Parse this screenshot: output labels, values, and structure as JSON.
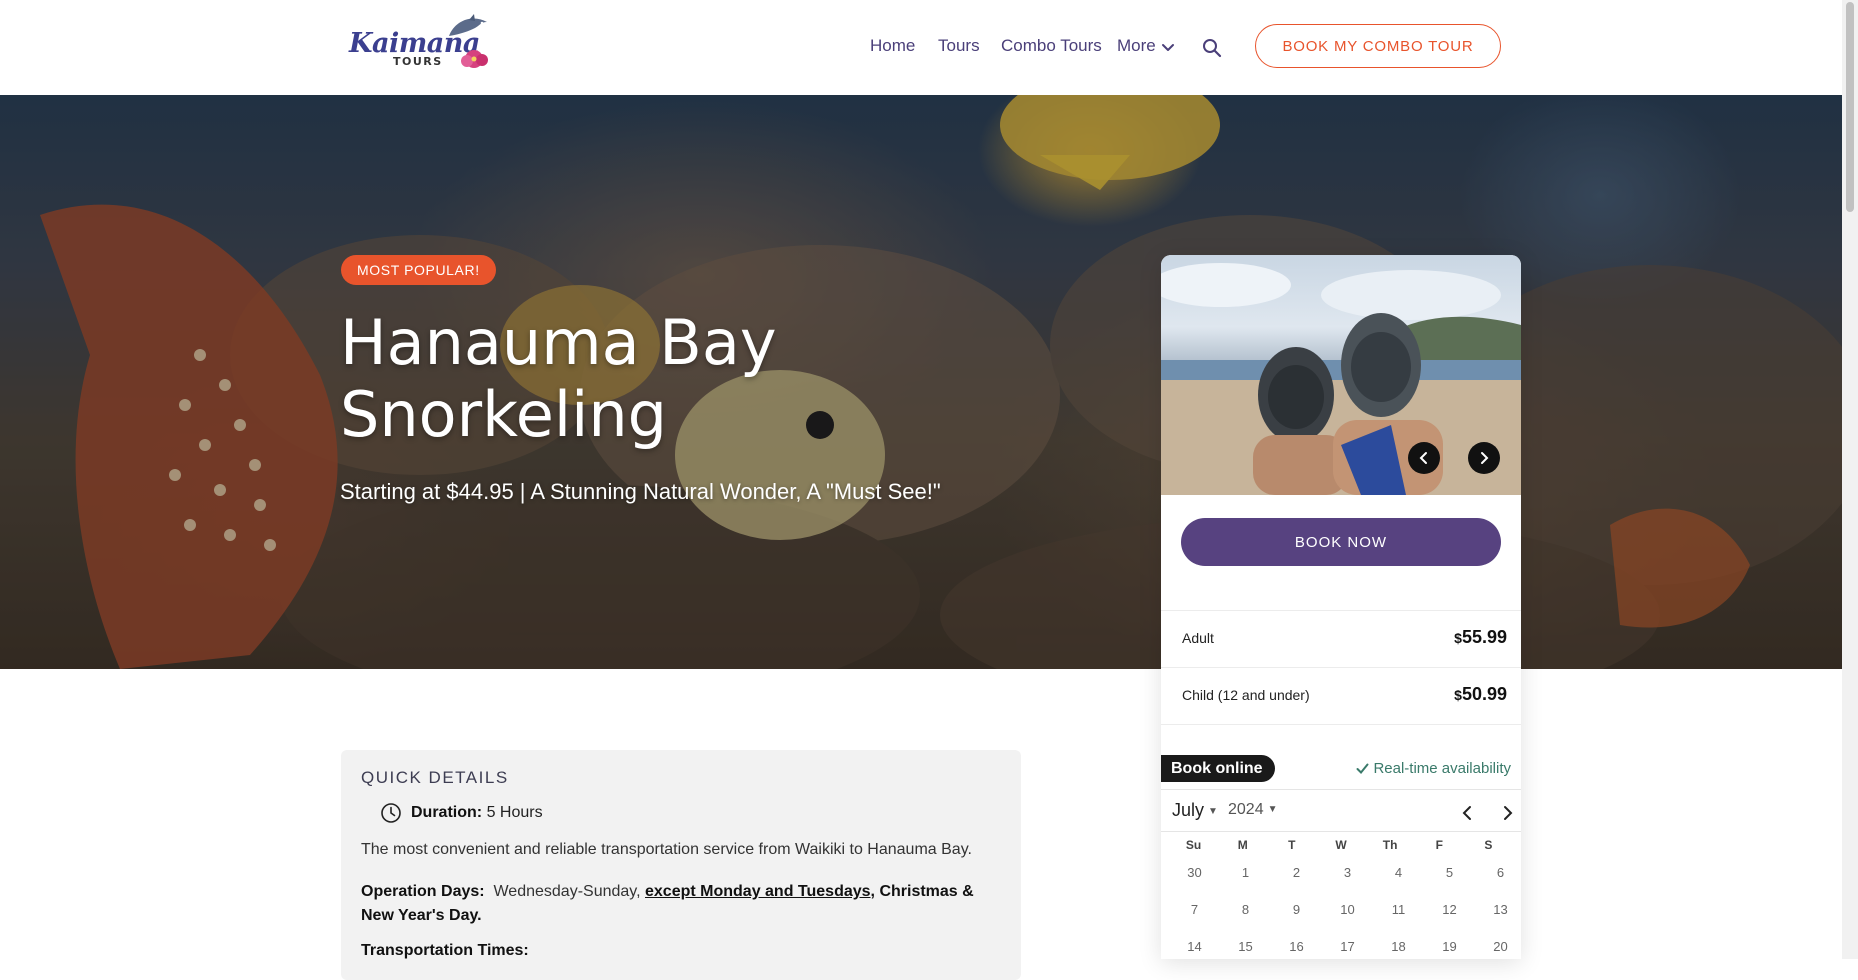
{
  "header": {
    "logo": {
      "script": "Kaimana",
      "sub": "TOURS"
    },
    "nav": [
      {
        "label": "Home"
      },
      {
        "label": "Tours"
      },
      {
        "label": "Combo Tours"
      },
      {
        "label": "More"
      }
    ],
    "cta_label": "BOOK MY COMBO TOUR"
  },
  "hero": {
    "badge": "MOST POPULAR!",
    "title": "Hanauma Bay Snorkeling",
    "subtitle": "Starting at $44.95 | A Stunning Natural Wonder, A \"Must See!\""
  },
  "booking": {
    "book_now_label": "BOOK NOW",
    "prices": [
      {
        "label": "Adult",
        "currency": "$",
        "amount": "55.99"
      },
      {
        "label": "Child (12 and under)",
        "currency": "$",
        "amount": "50.99"
      }
    ],
    "book_online": "Book online",
    "realtime": "Real-time availability",
    "calendar": {
      "month": "July",
      "year": "2024",
      "dow": [
        "Su",
        "M",
        "T",
        "W",
        "Th",
        "F",
        "S"
      ],
      "weeks": [
        [
          "30",
          "1",
          "2",
          "3",
          "4",
          "5",
          "6"
        ],
        [
          "7",
          "8",
          "9",
          "10",
          "11",
          "12",
          "13"
        ],
        [
          "14",
          "15",
          "16",
          "17",
          "18",
          "19",
          "20"
        ]
      ]
    }
  },
  "details": {
    "title": "QUICK DETAILS",
    "duration_label": "Duration:",
    "duration_value": "5 Hours",
    "description": "The most convenient and reliable transportation service from Waikiki to Hanauma Bay.",
    "op_label": "Operation Days:",
    "op_value": "Wednesday-Sunday,",
    "op_except": "except Monday and Tuesdays,",
    "op_holidays": "Christmas & New Year's Day.",
    "transport_label": "Transportation Times:"
  },
  "colors": {
    "accent": "#e8542c",
    "primary": "#574280",
    "nav": "#4a3f79"
  }
}
